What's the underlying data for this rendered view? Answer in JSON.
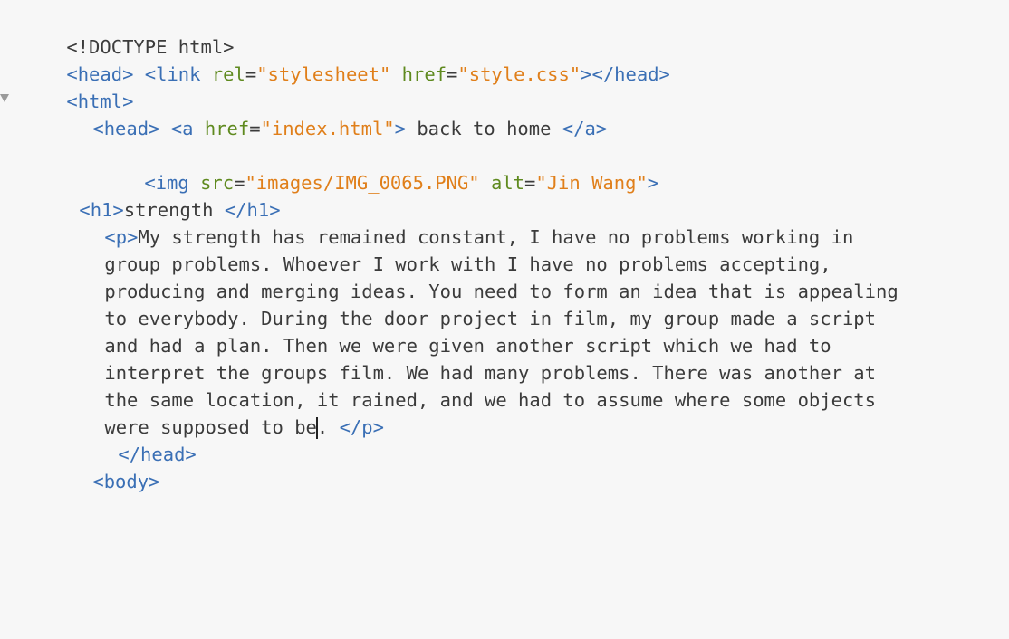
{
  "editor": {
    "lines": {
      "l1": {
        "doctype": "<!DOCTYPE html>"
      },
      "l2": {
        "open": "<head>",
        "link_open": "<link",
        "rel_attr": "rel",
        "eq": "=",
        "rel_val": "\"stylesheet\"",
        "href_attr": "href",
        "href_val": "\"style.css\"",
        "link_close": ">",
        "close": "</head>"
      },
      "l3": {
        "html": "<html>"
      },
      "l4": {
        "head": "<head>",
        "a_open": "<a",
        "href_attr": "href",
        "eq": "=",
        "href_val": "\"index.html\"",
        "gt": ">",
        "text": " back to home ",
        "a_close": "</a>"
      },
      "l5": {
        "img_open": "<img",
        "src_attr": "src",
        "eq": "=",
        "src_val": "\"images/IMG_0065.PNG\"",
        "alt_attr": "alt",
        "alt_val": "\"Jin Wang\"",
        "gt": ">"
      },
      "l6": {
        "h1_open": "<h1>",
        "text": "strength ",
        "h1_close": "</h1>"
      },
      "p": {
        "p_open": "<p>",
        "line1": "My strength has remained constant, I have no problems working in",
        "line2": "group problems. Whoever I work with I have no problems accepting,",
        "line3": "producing and merging ideas. You need to form an idea that is appealing",
        "line4": "to everybody. During the door project in film, my group made a script",
        "line5": "and had a plan. Then we were given another script which we had to",
        "line6": "interpret the groups film. We had many problems. There was another at",
        "line7": "the same location, it rained, and we had to assume where some objects",
        "line8a": "were supposed to be",
        "line8b": ". ",
        "p_close": "</p>"
      },
      "l15": {
        "head_close": "</head>"
      },
      "l16": {
        "body": "<body>"
      }
    },
    "icons": {
      "fold": "fold-triangle-icon",
      "caret": "text-cursor"
    },
    "colors": {
      "background": "#f7f7f7",
      "tag": "#3a6fb5",
      "attribute": "#5f8a1f",
      "string": "#e07f1a",
      "text": "#3b3b3b"
    }
  }
}
